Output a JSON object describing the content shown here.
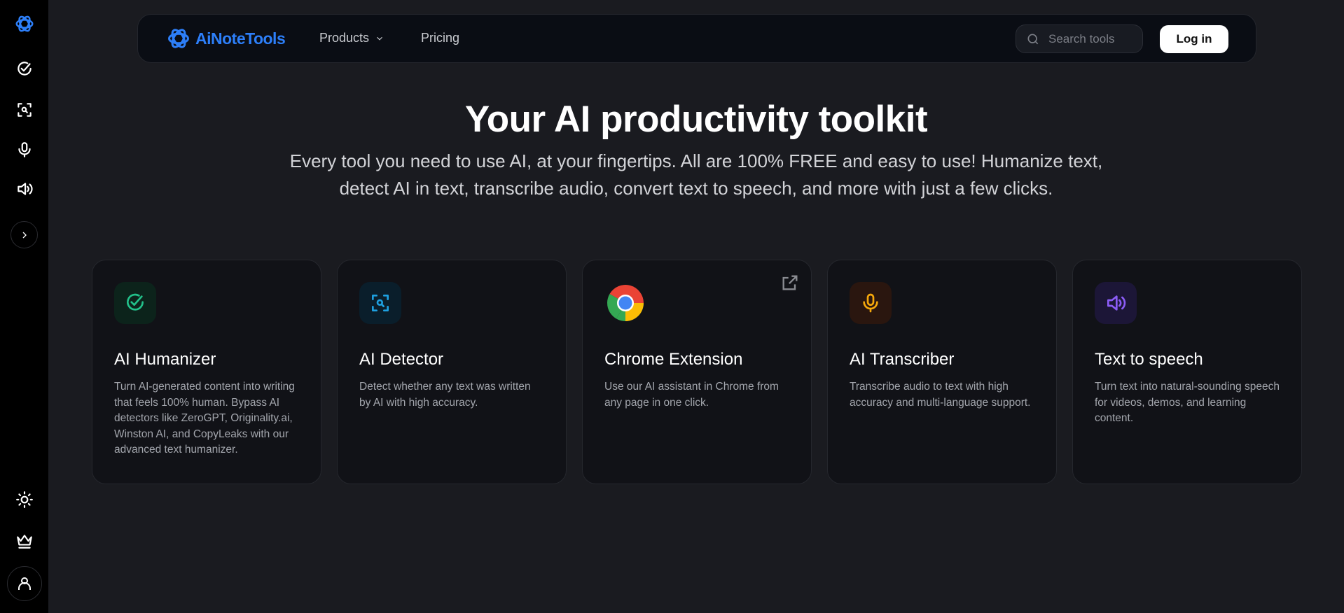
{
  "sidebar": {
    "items": [
      "logo-icon",
      "humanizer-icon",
      "detector-icon",
      "microphone-icon",
      "speaker-icon",
      "expand-icon"
    ],
    "bottom": [
      "sun-icon",
      "crown-icon",
      "user-icon"
    ]
  },
  "nav": {
    "brand": "AiNoteTools",
    "products": "Products",
    "pricing": "Pricing",
    "search_placeholder": "Search tools",
    "login": "Log in"
  },
  "hero": {
    "title": "Your AI productivity toolkit",
    "subtitle_line1": "Every tool you need to use AI, at your fingertips. All are 100% FREE and easy to use! Humanize text,",
    "subtitle_line2": "detect AI in text, transcribe audio, convert text to speech, and more with just a few clicks."
  },
  "cards": [
    {
      "title": "AI Humanizer",
      "desc": "Turn AI-generated content into writing that feels 100% human. Bypass AI detectors like ZeroGPT, Originality.ai, Winston AI, and CopyLeaks with our advanced text humanizer.",
      "color": "#22c08a"
    },
    {
      "title": "AI Detector",
      "desc": "Detect whether any text was written by AI with high accuracy.",
      "color": "#1ea0e0"
    },
    {
      "title": "Chrome Extension",
      "desc": "Use our AI assistant in Chrome from any page in one click."
    },
    {
      "title": "AI Transcriber",
      "desc": "Transcribe audio to text with high accuracy and multi-language support.",
      "color": "#f5a70b"
    },
    {
      "title": "Text to speech",
      "desc": "Turn text into natural-sounding speech for videos, demos, and learning content.",
      "color": "#8b5cf6"
    }
  ]
}
